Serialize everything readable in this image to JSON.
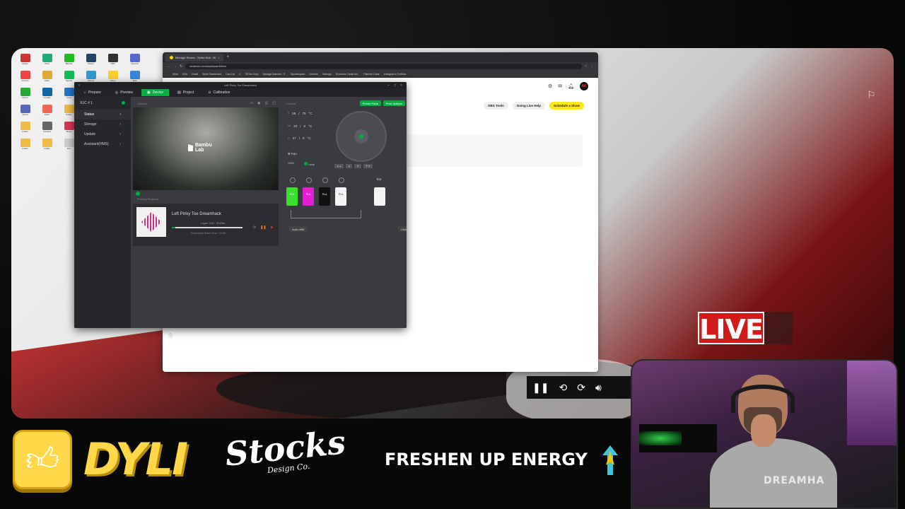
{
  "desktop": {
    "icons": [
      {
        "label": "Adobe",
        "color": "#c33"
      },
      {
        "label": "Xbox",
        "color": "#2a7"
      },
      {
        "label": "Bambu",
        "color": "#2b2"
      },
      {
        "label": "Steam",
        "color": "#246"
      },
      {
        "label": "OBS",
        "color": "#333"
      },
      {
        "label": "Discord",
        "color": "#56c"
      },
      {
        "label": "Chrome",
        "color": "#e44"
      },
      {
        "label": "Files",
        "color": "#da3"
      },
      {
        "label": "Spotify",
        "color": "#1b5"
      },
      {
        "label": "Photos",
        "color": "#39c"
      },
      {
        "label": "Notes",
        "color": "#fc3"
      },
      {
        "label": "Mail",
        "color": "#38d"
      },
      {
        "label": "Green",
        "color": "#2a3"
      },
      {
        "label": "Creality",
        "color": "#16a"
      },
      {
        "label": "Cura",
        "color": "#27c"
      },
      {
        "label": "Blender",
        "color": "#e83"
      },
      {
        "label": "Slicer",
        "color": "#555"
      },
      {
        "label": "Store",
        "color": "#c22"
      },
      {
        "label": "Teams",
        "color": "#56b"
      },
      {
        "label": "Paint",
        "color": "#e65"
      },
      {
        "label": "Folder",
        "color": "#eb4"
      },
      {
        "label": "Folder",
        "color": "#eb4"
      },
      {
        "label": "Excel",
        "color": "#2a6"
      },
      {
        "label": "Word",
        "color": "#25b"
      },
      {
        "label": "Folder",
        "color": "#eb4"
      },
      {
        "label": "Camera",
        "color": "#666"
      },
      {
        "label": "Music",
        "color": "#d35"
      },
      {
        "label": "Game",
        "color": "#a33"
      },
      {
        "label": "App",
        "color": "#3b6"
      },
      {
        "label": "Tool",
        "color": "#888"
      },
      {
        "label": "Folder",
        "color": "#eb4"
      },
      {
        "label": "Folder",
        "color": "#eb4"
      },
      {
        "label": "Doc",
        "color": "#ccc"
      },
      {
        "label": "Doc",
        "color": "#ccc"
      },
      {
        "label": "App",
        "color": "#c44"
      },
      {
        "label": "App",
        "color": "#4a4"
      }
    ]
  },
  "browser": {
    "tabs": [
      {
        "label": "Manage Shows - Seller Hub - W"
      },
      {
        "label": "+"
      }
    ],
    "url": "whatnot.com/dashboard/lives",
    "bookmarks": [
      "Work",
      "Kids",
      "Gmail",
      "Seller Dashboard",
      "Cart List",
      "X",
      "TikTok Shop",
      "Manage Batches - P..",
      "Squarespace",
      "Linktree",
      "Settings",
      "Wooloma Credit Uni..",
      "Filament Code",
      "Instagram's Portfolio"
    ],
    "actions": [
      "OBS Tools",
      "Going Live Help",
      "Schedule a Show"
    ],
    "avatar_text": "AK"
  },
  "bambu": {
    "title": "Left Pinky Toe Dreamhack",
    "tabs": [
      "Prepare",
      "Preview",
      "Device",
      "Project",
      "Calibration"
    ],
    "active_tab": "Device",
    "device_name": "X1C # 1",
    "side_items": [
      "Status",
      "Storage",
      "Update",
      "Assistant(HMS)"
    ],
    "camera_label": "Camera",
    "camera_logo": "Bambu\nLab",
    "printing_progress_label": "Printing Progress",
    "job_name": "Left Pinky Toe Dreamhack",
    "layer_text": "Layer: 0/11    -3h23m",
    "progress": 0.05,
    "eta": "Estimated finish time: 19:46",
    "control_label": "Control",
    "printer_parts": "Printer Parts",
    "print_options": "Print Options",
    "temps": [
      {
        "sym": "⌇",
        "val": "55",
        "target": "75",
        "unit": "°C"
      },
      {
        "sym": "▭",
        "val": "23",
        "target": "0",
        "unit": "°C"
      },
      {
        "sym": "□",
        "val": "27",
        "target": "0",
        "unit": "°C"
      }
    ],
    "fan_label": "Fan",
    "fan_pct": "100%",
    "lamp_label": "Lamp",
    "ext_label": "Ext",
    "slots": [
      {
        "mat": "PLA",
        "color": "#3adf2b"
      },
      {
        "mat": "PLA",
        "color": "#e41fd1"
      },
      {
        "mat": "PLA",
        "color": "#111111"
      },
      {
        "mat": "PLA",
        "color": "#f5f5f5"
      }
    ],
    "auto_refill": "Auto-refill",
    "unload": "Unload"
  },
  "overlay": {
    "live_text": "LIVE",
    "sponsor_dyli": "DYLI",
    "sponsor_stocks": "Stocks",
    "sponsor_stocks_sub": "Design Co.",
    "sponsor_freshen": "FRESHEN UP ENERGY",
    "shirt_text": "DREAMHA"
  }
}
